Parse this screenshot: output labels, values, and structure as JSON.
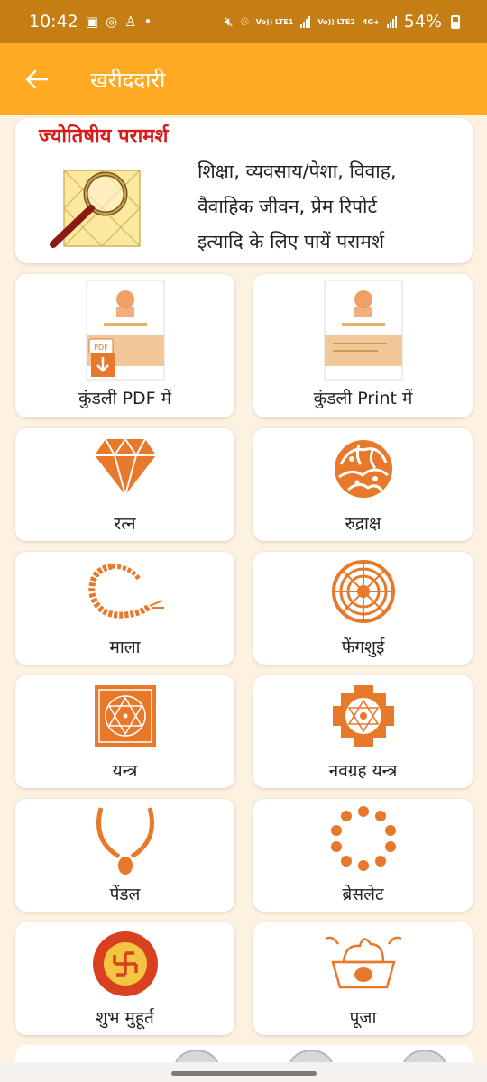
{
  "status_bar": {
    "time": "10:42",
    "net1": "Vo)) LTE1",
    "net2": "Vo)) LTE2",
    "net2_type": "4G+",
    "battery": "54%"
  },
  "app_bar": {
    "title": "खरीददारी"
  },
  "consult": {
    "title": "ज्योतिषीय परामर्श",
    "line1": "शिक्षा, व्यवसाय/पेशा, विवाह,",
    "line2": "वैवाहिक जीवन, प्रेम रिपोर्ट",
    "line3": "इत्यादि के लिए पायें परामर्श"
  },
  "items": [
    {
      "label": "कुंडली PDF में",
      "icon": "kundli-pdf-icon"
    },
    {
      "label": "कुंडली Print में",
      "icon": "kundli-print-icon"
    },
    {
      "label": "रत्न",
      "icon": "gem-icon"
    },
    {
      "label": "रुद्राक्ष",
      "icon": "rudraksha-icon"
    },
    {
      "label": "माला",
      "icon": "mala-icon"
    },
    {
      "label": "फेंगशुई",
      "icon": "fengshui-icon"
    },
    {
      "label": "यन्त्र",
      "icon": "yantra-icon"
    },
    {
      "label": "नवग्रह यन्त्र",
      "icon": "navgrah-yantra-icon"
    },
    {
      "label": "पेंडल",
      "icon": "pendant-icon"
    },
    {
      "label": "ब्रेसलेट",
      "icon": "bracelet-icon"
    },
    {
      "label": "शुभ मुहूर्त",
      "icon": "swastik-icon"
    },
    {
      "label": "पूजा",
      "icon": "puja-icon"
    }
  ],
  "colors": {
    "status_bar": "#c57e13",
    "app_bar": "#ffaa22",
    "background": "#fdf1e1",
    "icon_orange": "#e8782a",
    "consult_title": "#d81b1b"
  }
}
